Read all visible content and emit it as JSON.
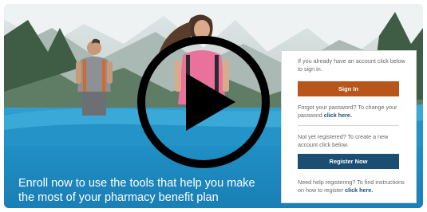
{
  "hero": {
    "tagline": "Enroll now to use the tools that help you make the most of your pharmacy benefit plan"
  },
  "login_panel": {
    "existing_text": "If you already have an account click below to sign in.",
    "sign_in_label": "Sign In",
    "forgot_prefix": "Forgot your password? To change your password ",
    "forgot_link": "click here.",
    "not_registered_text": "Not yet registered? To create a new account click below.",
    "register_label": "Register Now",
    "help_prefix": "Need help registering? To find instructions on how to register ",
    "help_link": "click here."
  },
  "video": {
    "play_icon": "play-icon"
  },
  "colors": {
    "sign_in": "#b8551b",
    "register": "#1b4f72",
    "band": "#1f8fc4"
  }
}
